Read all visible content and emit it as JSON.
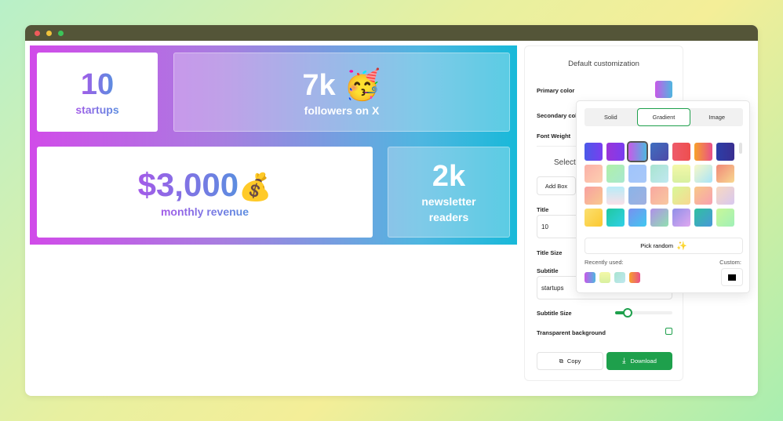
{
  "window": {
    "dots": [
      "#ee5b5b",
      "#f0c33c",
      "#3cc45a"
    ]
  },
  "canvas": {
    "boxes": [
      {
        "title": "10",
        "subtitle": "startups"
      },
      {
        "title": "7k",
        "emoji": "🥳",
        "subtitle": "followers on X"
      },
      {
        "title": "$3,000",
        "emoji": "💰",
        "subtitle": "monthly revenue"
      },
      {
        "title": "2k",
        "subtitle": "newsletter readers"
      }
    ]
  },
  "panel": {
    "heading": "Default customization",
    "primary_color": "Primary color",
    "secondary_color": "Secondary color",
    "font_weight": "Font Weight",
    "select": "Select",
    "add_box": "Add Box",
    "title_label": "Title",
    "title_value": "10",
    "title_size": "Title Size",
    "subtitle_label": "Subtitle",
    "subtitle_value": "startups",
    "subtitle_size": "Subtitle Size",
    "subtitle_size_value": 0.25,
    "transparent": "Transparent background",
    "copy": "Copy",
    "download": "Download",
    "accent": "#1ea04c"
  },
  "picker": {
    "tabs": [
      "Solid",
      "Gradient",
      "Image"
    ],
    "active_tab": "Gradient",
    "pick_random": "Pick random",
    "recently_used": "Recently used:",
    "custom": "Custom:",
    "custom_color": "#000000",
    "swatches": [
      "linear-gradient(90deg,#4a5ae8,#7a3ef0)",
      "linear-gradient(90deg,#9a34d8,#7a3ef0)",
      "linear-gradient(90deg,#c75ae8,#4fb6e0)",
      "linear-gradient(135deg,#3f6fc0,#4e4aa8)",
      "linear-gradient(90deg,#ee5a6a,#ee4f4f)",
      "linear-gradient(90deg,#f7a12a,#e8508a)",
      "linear-gradient(90deg,#2c3ea8,#3a2f90)",
      "linear-gradient(135deg,#fbb0a8,#fccfb0)",
      "linear-gradient(135deg,#b0f0a8,#a8e8d0)",
      "linear-gradient(135deg,#a0c4fc,#a8c8f8)",
      "linear-gradient(135deg,#a8e4d0,#c0e8f0)",
      "linear-gradient(180deg,#f4f8a8,#d8f0a0)",
      "linear-gradient(135deg,#f8f8c8,#a8e4f8)",
      "linear-gradient(135deg,#f08878,#f8d890)",
      "linear-gradient(135deg,#f8a0a0,#f8c890)",
      "linear-gradient(180deg,#b8ecf8,#f8e0e8)",
      "linear-gradient(135deg,#8ab4e8,#a0b0e0)",
      "linear-gradient(135deg,#f8a8a0,#f8c8a0)",
      "linear-gradient(135deg,#d8f898,#f8d890)",
      "linear-gradient(135deg,#f8c888,#f8a0b0)",
      "linear-gradient(135deg,#f8d8c0,#d8c8f0)",
      "linear-gradient(135deg,#fbe070,#fbc830)",
      "linear-gradient(135deg,#20c8a0,#30d0e8)",
      "linear-gradient(135deg,#7890f0,#40c8f0)",
      "linear-gradient(135deg,#b090e8,#90e0b0)",
      "linear-gradient(135deg,#9090e8,#e0a8f0)",
      "linear-gradient(135deg,#30c0a0,#4898d8)",
      "linear-gradient(135deg,#c8f898,#a0f0b8)"
    ],
    "recent": [
      "linear-gradient(90deg,#c75ae8,#4fb6e0)",
      "linear-gradient(180deg,#f4f8a8,#d8f0a0)",
      "linear-gradient(135deg,#a8e4d0,#c0e8f0)",
      "linear-gradient(90deg,#f7a12a,#e8508a)"
    ]
  }
}
